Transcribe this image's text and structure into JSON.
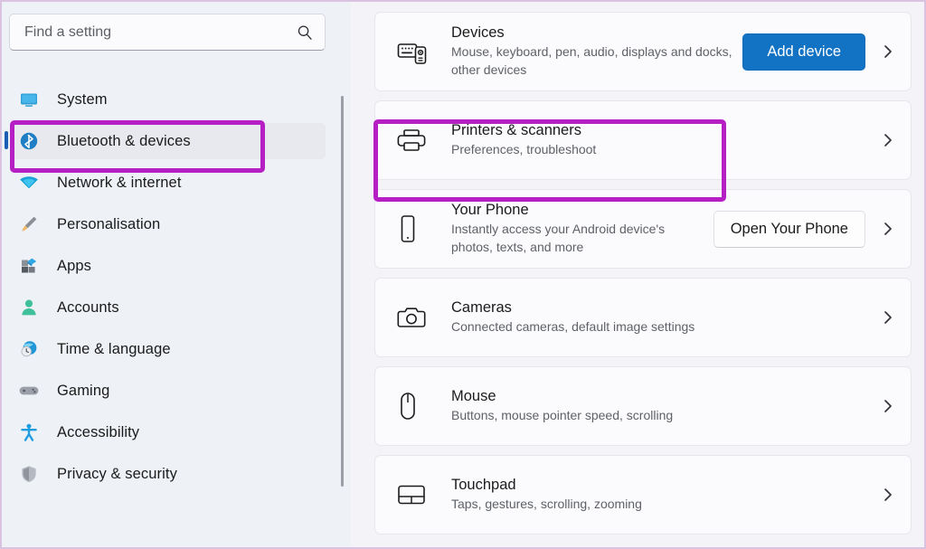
{
  "window": {
    "title": "Settings",
    "accent_purple": "#b61fc4",
    "accent_blue": "#1273c4"
  },
  "search": {
    "placeholder": "Find a setting",
    "value": "",
    "icon": "search-icon"
  },
  "sidebar": {
    "items": [
      {
        "label": "System",
        "icon": "display-icon",
        "selected": false
      },
      {
        "label": "Bluetooth & devices",
        "icon": "bluetooth-icon",
        "selected": true
      },
      {
        "label": "Network & internet",
        "icon": "wifi-icon",
        "selected": false
      },
      {
        "label": "Personalisation",
        "icon": "paintbrush-icon",
        "selected": false
      },
      {
        "label": "Apps",
        "icon": "apps-icon",
        "selected": false
      },
      {
        "label": "Accounts",
        "icon": "person-icon",
        "selected": false
      },
      {
        "label": "Time & language",
        "icon": "clock-globe-icon",
        "selected": false
      },
      {
        "label": "Gaming",
        "icon": "gamepad-icon",
        "selected": false
      },
      {
        "label": "Accessibility",
        "icon": "accessibility-icon",
        "selected": false
      },
      {
        "label": "Privacy & security",
        "icon": "shield-icon",
        "selected": false
      }
    ]
  },
  "main": {
    "cards": [
      {
        "title": "Devices",
        "subtitle": "Mouse, keyboard, pen, audio, displays and docks, other devices",
        "icon": "devices-icon",
        "button": {
          "label": "Add device",
          "style": "primary"
        },
        "chevron": "chevron-right-icon"
      },
      {
        "title": "Printers & scanners",
        "subtitle": "Preferences, troubleshoot",
        "icon": "printer-icon",
        "button": null,
        "chevron": "chevron-right-icon"
      },
      {
        "title": "Your Phone",
        "subtitle": "Instantly access your Android device's photos, texts, and more",
        "icon": "phone-icon",
        "button": {
          "label": "Open Your Phone",
          "style": "secondary"
        },
        "chevron": "chevron-right-icon"
      },
      {
        "title": "Cameras",
        "subtitle": "Connected cameras, default image settings",
        "icon": "camera-icon",
        "button": null,
        "chevron": "chevron-right-icon"
      },
      {
        "title": "Mouse",
        "subtitle": "Buttons, mouse pointer speed, scrolling",
        "icon": "mouse-icon",
        "button": null,
        "chevron": "chevron-right-icon"
      },
      {
        "title": "Touchpad",
        "subtitle": "Taps, gestures, scrolling, zooming",
        "icon": "touchpad-icon",
        "button": null,
        "chevron": "chevron-right-icon"
      }
    ]
  },
  "annotations": [
    {
      "name": "highlight-bluetooth-devices",
      "color": "#b61fc4"
    },
    {
      "name": "highlight-printers-scanners",
      "color": "#b61fc4"
    }
  ]
}
